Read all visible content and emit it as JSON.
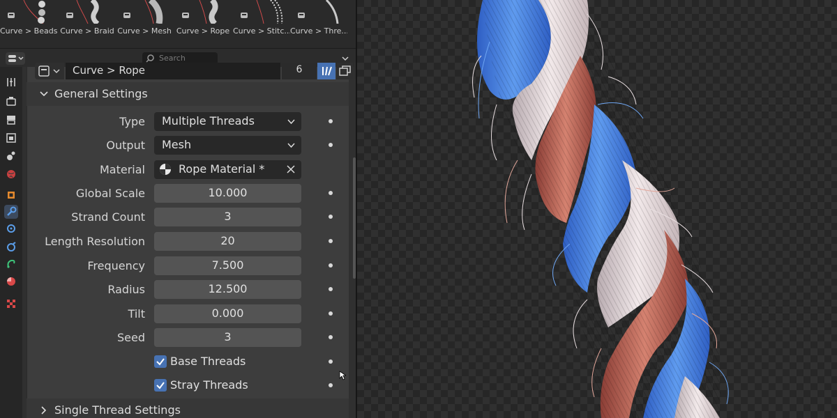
{
  "asset_browser": {
    "items": [
      {
        "label": "Curve > Beads"
      },
      {
        "label": "Curve > Braid"
      },
      {
        "label": "Curve > Mesh"
      },
      {
        "label": "Curve > Rope"
      },
      {
        "label": "Curve > Stitc..."
      },
      {
        "label": "Curve > Thre..."
      }
    ]
  },
  "header": {
    "search_placeholder": "Search"
  },
  "modifier": {
    "node_group_name": "Curve > Rope",
    "user_count": "6"
  },
  "general_settings": {
    "title": "General Settings",
    "type_label": "Type",
    "type_value": "Multiple Threads",
    "output_label": "Output",
    "output_value": "Mesh",
    "material_label": "Material",
    "material_value": "Rope Material *",
    "global_scale_label": "Global Scale",
    "global_scale_value": "10.000",
    "strand_count_label": "Strand Count",
    "strand_count_value": "3",
    "length_resolution_label": "Length Resolution",
    "length_resolution_value": "20",
    "frequency_label": "Frequency",
    "frequency_value": "7.500",
    "radius_label": "Radius",
    "radius_value": "12.500",
    "tilt_label": "Tilt",
    "tilt_value": "0.000",
    "seed_label": "Seed",
    "seed_value": "3",
    "base_threads_label": "Base Threads",
    "base_threads_checked": true,
    "stray_threads_label": "Stray Threads",
    "stray_threads_checked": true
  },
  "single_thread_settings": {
    "title": "Single Thread Settings"
  },
  "colors": {
    "accent_blue": "#4772b3",
    "rope_blue": "#3d7be0",
    "rope_white": "#e8dcdc",
    "rope_red": "#c06a5a"
  }
}
